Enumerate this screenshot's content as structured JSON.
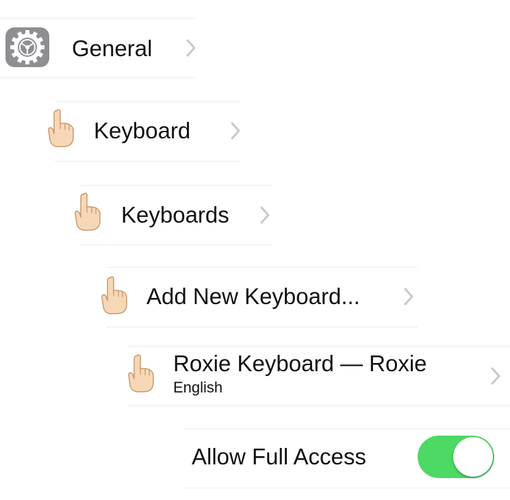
{
  "colors": {
    "toggle_on": "#4cd964",
    "settings_icon_bg": "#8e8e93",
    "chevron": "#c7c7cc",
    "separator": "#ececef"
  },
  "rows": [
    {
      "label": "General",
      "icon": "gear-icon"
    },
    {
      "label": "Keyboard",
      "icon": "pointing-hand-icon"
    },
    {
      "label": "Keyboards",
      "icon": "pointing-hand-icon"
    },
    {
      "label": "Add New Keyboard...",
      "icon": "pointing-hand-icon"
    },
    {
      "label": "Roxie Keyboard — Roxie",
      "sublabel": "English",
      "icon": "pointing-hand-icon"
    },
    {
      "label": "Allow Full Access",
      "toggle_on": true
    }
  ]
}
